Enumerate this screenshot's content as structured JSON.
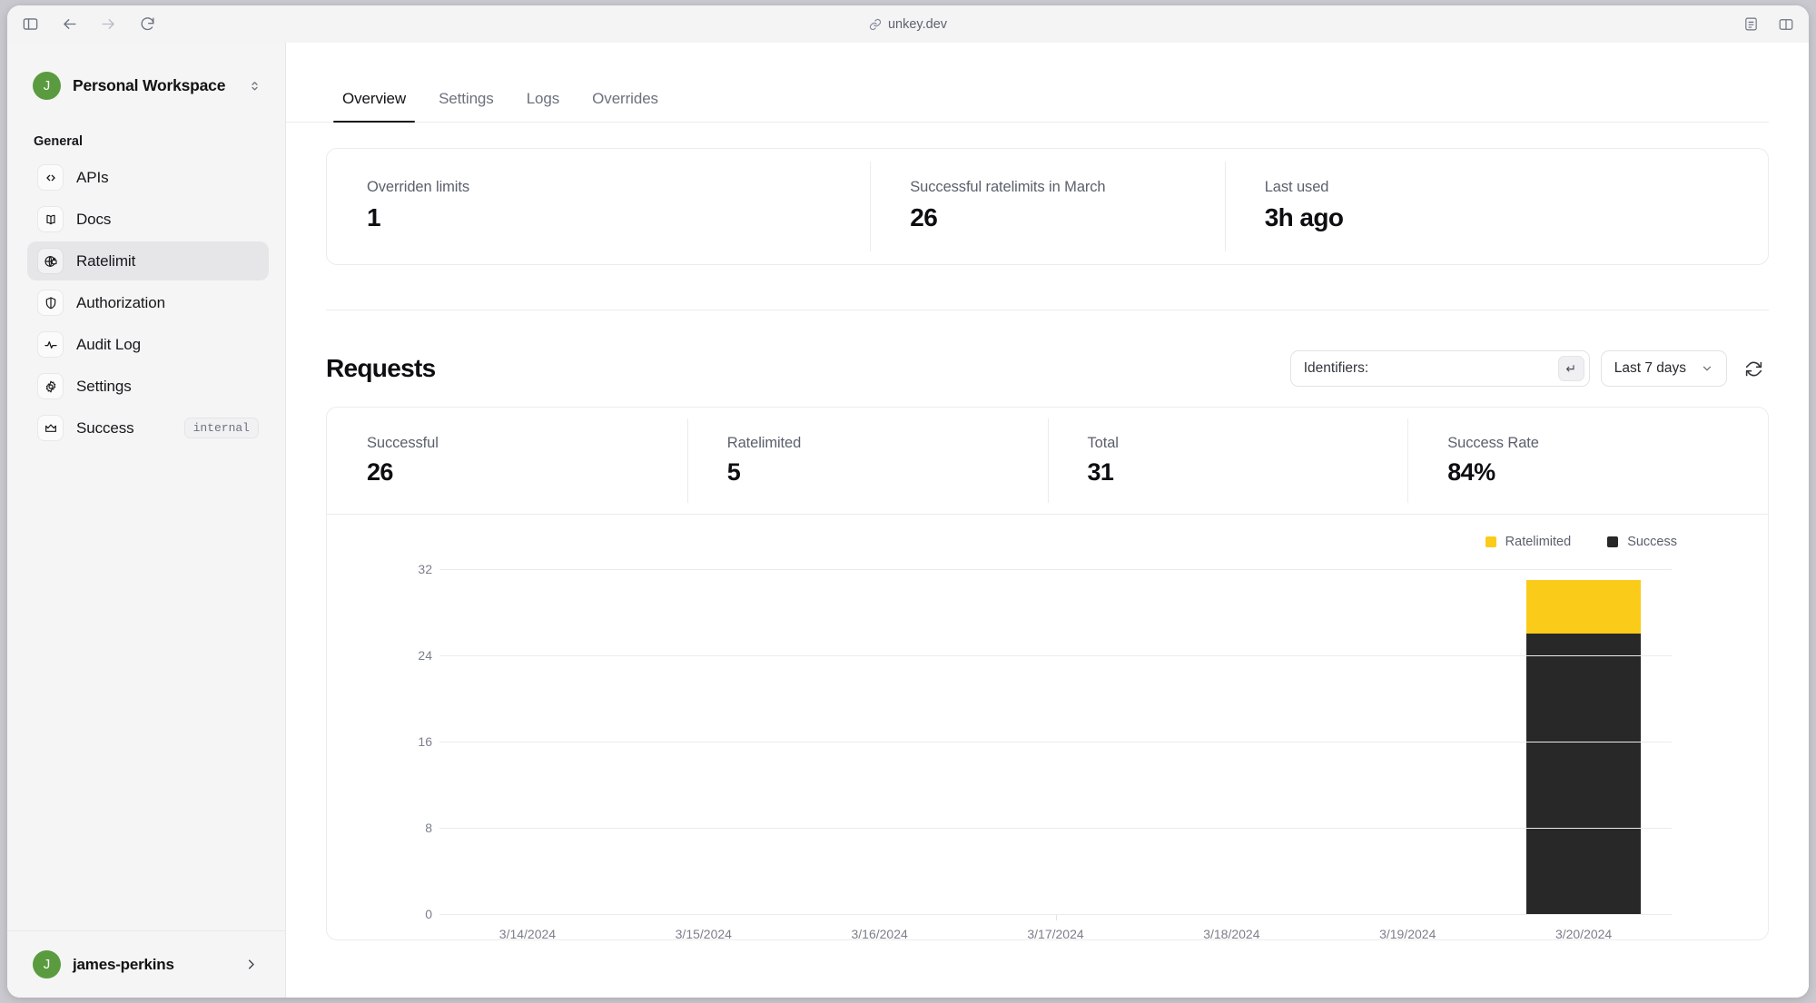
{
  "browser": {
    "url_title": "unkey.dev",
    "back_icon": "back-arrow-icon",
    "forward_icon": "forward-arrow-icon",
    "reload_icon": "reload-icon",
    "sidebar_toggle_icon": "sidebar-toggle-icon",
    "reader_icon": "reader-view-icon",
    "panel_icon": "panel-toggle-icon"
  },
  "sidebar": {
    "workspace": {
      "initial": "J",
      "name": "Personal Workspace"
    },
    "section_label": "General",
    "items": [
      {
        "label": "APIs",
        "icon": "code-brackets-icon",
        "active": false,
        "badge": ""
      },
      {
        "label": "Docs",
        "icon": "book-icon",
        "active": false,
        "badge": ""
      },
      {
        "label": "Ratelimit",
        "icon": "globe-lock-icon",
        "active": true,
        "badge": ""
      },
      {
        "label": "Authorization",
        "icon": "shield-icon",
        "active": false,
        "badge": ""
      },
      {
        "label": "Audit Log",
        "icon": "activity-pulse-icon",
        "active": false,
        "badge": ""
      },
      {
        "label": "Settings",
        "icon": "gear-icon",
        "active": false,
        "badge": ""
      },
      {
        "label": "Success",
        "icon": "crown-icon",
        "active": false,
        "badge": "internal"
      }
    ],
    "user": {
      "initial": "J",
      "name": "james-perkins",
      "chevron_icon": "chevron-right-icon"
    }
  },
  "tabs": [
    {
      "label": "Overview",
      "active": true
    },
    {
      "label": "Settings",
      "active": false
    },
    {
      "label": "Logs",
      "active": false
    },
    {
      "label": "Overrides",
      "active": false
    }
  ],
  "summary": [
    {
      "label": "Overriden limits",
      "value": "1"
    },
    {
      "label": "Successful ratelimits in March",
      "value": "26"
    },
    {
      "label": "Last used",
      "value": "3h ago"
    }
  ],
  "requests": {
    "title": "Requests",
    "identifiers": {
      "label": "Identifiers:",
      "value": "",
      "placeholder": "",
      "enter_icon": "enter-key-icon"
    },
    "range": {
      "label": "Last 7 days",
      "chevron_icon": "chevron-down-icon"
    },
    "refresh_icon": "refresh-icon",
    "stats": [
      {
        "label": "Successful",
        "value": "26"
      },
      {
        "label": "Ratelimited",
        "value": "5"
      },
      {
        "label": "Total",
        "value": "31"
      },
      {
        "label": "Success Rate",
        "value": "84%"
      }
    ]
  },
  "chart_data": {
    "type": "bar",
    "stacked": true,
    "title": "Requests",
    "xlabel": "",
    "ylabel": "",
    "ylim": [
      0,
      32
    ],
    "yticks": [
      32,
      24,
      16,
      8,
      0
    ],
    "grid": true,
    "legend_position": "top-right",
    "categories": [
      "3/14/2024",
      "3/15/2024",
      "3/16/2024",
      "3/17/2024",
      "3/18/2024",
      "3/19/2024",
      "3/20/2024"
    ],
    "series": [
      {
        "name": "Success",
        "color": "#282828",
        "values": [
          0,
          0,
          0,
          0,
          0,
          0,
          26
        ]
      },
      {
        "name": "Ratelimited",
        "color": "#fbcb1a",
        "values": [
          0,
          0,
          0,
          0,
          0,
          0,
          5
        ]
      }
    ]
  },
  "colors": {
    "ratelimited": "#fbcb1a",
    "success": "#282828",
    "avatar": "#5a9b3f"
  }
}
